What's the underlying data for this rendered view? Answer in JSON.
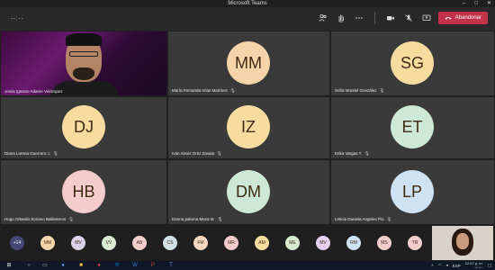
{
  "window": {
    "title": "Microsoft Teams",
    "controls": [
      "–",
      "□",
      "✕"
    ]
  },
  "toolbar": {
    "timer": "--:--",
    "leave_label": "Abandonar"
  },
  "tiles": [
    {
      "name": "Jesús Ignacio Adame Velázquez",
      "initials": "",
      "video": true
    },
    {
      "name": "María Fernanda Arias Martínez",
      "initials": "MM",
      "color": "#f4d4a8"
    },
    {
      "name": "Sofía Montiel González",
      "initials": "SG",
      "color": "#f7dca0"
    },
    {
      "name": "Diana Lorena Guerrero J.",
      "initials": "DJ",
      "color": "#f7dca0"
    },
    {
      "name": "Iván Alexis Ortiz Zavala",
      "initials": "IZ",
      "color": "#f7dca0"
    },
    {
      "name": "Erika Vargas T.",
      "initials": "ET",
      "color": "#cde8d6"
    },
    {
      "name": "Hugo Orlando Soriano Ballesteros",
      "initials": "HB",
      "color": "#f4cccc"
    },
    {
      "name": "Danna paloma Meza M.",
      "initials": "DM",
      "color": "#cde8d6"
    },
    {
      "name": "Leticia Daniela Angeles Pio",
      "initials": "LP",
      "color": "#cfe2f3"
    }
  ],
  "overflow": {
    "more_label": "+14",
    "avatars": [
      {
        "initials": "MM",
        "color": "#f4d4a8"
      },
      {
        "initials": "MV",
        "color": "#d9d2e9"
      },
      {
        "initials": "VV",
        "color": "#d9ead3"
      },
      {
        "initials": "AB",
        "color": "#f4cccc"
      },
      {
        "initials": "CS",
        "color": "#d0e0e3"
      },
      {
        "initials": "FM",
        "color": "#f9d7c0"
      },
      {
        "initials": "MR",
        "color": "#f4cccc"
      },
      {
        "initials": "AM",
        "color": "#f7dca0"
      },
      {
        "initials": "ME",
        "color": "#d9ead3"
      },
      {
        "initials": "MV",
        "color": "#e6d0f0"
      },
      {
        "initials": "RM",
        "color": "#cfe2f3"
      },
      {
        "initials": "MS",
        "color": "#f4cccc"
      },
      {
        "initials": "TR",
        "color": "#f4cccc"
      }
    ]
  },
  "taskbar": {
    "lang": "ESP",
    "time": "12:07 p. m.",
    "date": "--/--/--"
  }
}
